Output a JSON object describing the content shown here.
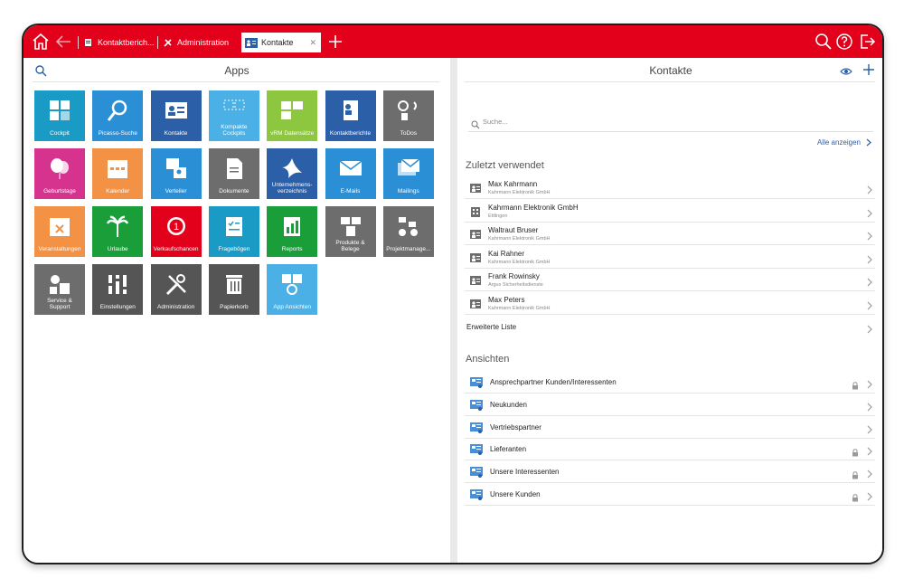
{
  "tabs": [
    {
      "label": "Kontaktberich..."
    },
    {
      "label": "Administration"
    },
    {
      "label": "Kontakte"
    }
  ],
  "apps": {
    "title": "Apps",
    "tiles": [
      {
        "label": "Cockpit",
        "color": "#1a9bc5"
      },
      {
        "label": "Picasso-Suche",
        "color": "#2b8fd6"
      },
      {
        "label": "Kontakte",
        "color": "#2b5fa8"
      },
      {
        "label": "Kompakte Cockpits",
        "color": "#4ab0e6"
      },
      {
        "label": "vRM Datensätze",
        "color": "#8dc63f"
      },
      {
        "label": "Kontaktberichte",
        "color": "#2b5fa8"
      },
      {
        "label": "ToDos",
        "color": "#6d6d6d"
      },
      {
        "label": "Geburtstage",
        "color": "#d6338f"
      },
      {
        "label": "Kalender",
        "color": "#f39145"
      },
      {
        "label": "Verteiler",
        "color": "#2b8fd6"
      },
      {
        "label": "Dokumente",
        "color": "#6d6d6d"
      },
      {
        "label": "Unternehmens-verzeichnis",
        "color": "#2b5fa8"
      },
      {
        "label": "E-Mails",
        "color": "#2b8fd6"
      },
      {
        "label": "Mailings",
        "color": "#2b8fd6"
      },
      {
        "label": "Veranstaltungen",
        "color": "#f39145"
      },
      {
        "label": "Urlaube",
        "color": "#1a9e3a"
      },
      {
        "label": "Verkaufschancen",
        "color": "#e2001a"
      },
      {
        "label": "Fragebögen",
        "color": "#1a9bc5"
      },
      {
        "label": "Reports",
        "color": "#1a9e3a"
      },
      {
        "label": "Produkte & Belege",
        "color": "#6d6d6d"
      },
      {
        "label": "Projektmanage...",
        "color": "#6d6d6d"
      },
      {
        "label": "Service & Support",
        "color": "#6d6d6d"
      },
      {
        "label": "Einstellungen",
        "color": "#555555"
      },
      {
        "label": "Administration",
        "color": "#555555"
      },
      {
        "label": "Papierkorb",
        "color": "#555555"
      },
      {
        "label": "App Ansichten",
        "color": "#4ab0e6"
      }
    ]
  },
  "contacts": {
    "title": "Kontakte",
    "search_placeholder": "Suche...",
    "show_all": "Alle anzeigen",
    "recent_heading": "Zuletzt verwendet",
    "recent": [
      {
        "name": "Max Kahrmann",
        "sub": "Kahrmann Elektronik GmbH",
        "icon": "person-card-icon"
      },
      {
        "name": "Kahrmann Elektronik GmbH",
        "sub": "Ettlingen",
        "icon": "building-icon"
      },
      {
        "name": "Waltraut Bruser",
        "sub": "Kahrmann Elektronik GmbH",
        "icon": "person-card-icon"
      },
      {
        "name": "Kai Rahner",
        "sub": "Kahrmann Elektronik GmbH",
        "icon": "person-card-icon"
      },
      {
        "name": "Frank Rowinsky",
        "sub": "Argus Sicherheitsdienste",
        "icon": "person-card-icon"
      },
      {
        "name": "Max Peters",
        "sub": "Kahrmann Elektronik GmbH",
        "icon": "person-card-icon"
      }
    ],
    "extended_list": "Erweiterte Liste",
    "views_heading": "Ansichten",
    "views": [
      {
        "name": "Ansprechpartner Kunden/Interessenten",
        "locked": true
      },
      {
        "name": "Neukunden",
        "locked": false
      },
      {
        "name": "Vertriebspartner",
        "locked": false
      },
      {
        "name": "Lieferanten",
        "locked": true
      },
      {
        "name": "Unsere Interessenten",
        "locked": true
      },
      {
        "name": "Unsere Kunden",
        "locked": true
      }
    ]
  },
  "colors": {
    "brand_red": "#e2001a",
    "link_blue": "#2b5fa8"
  }
}
